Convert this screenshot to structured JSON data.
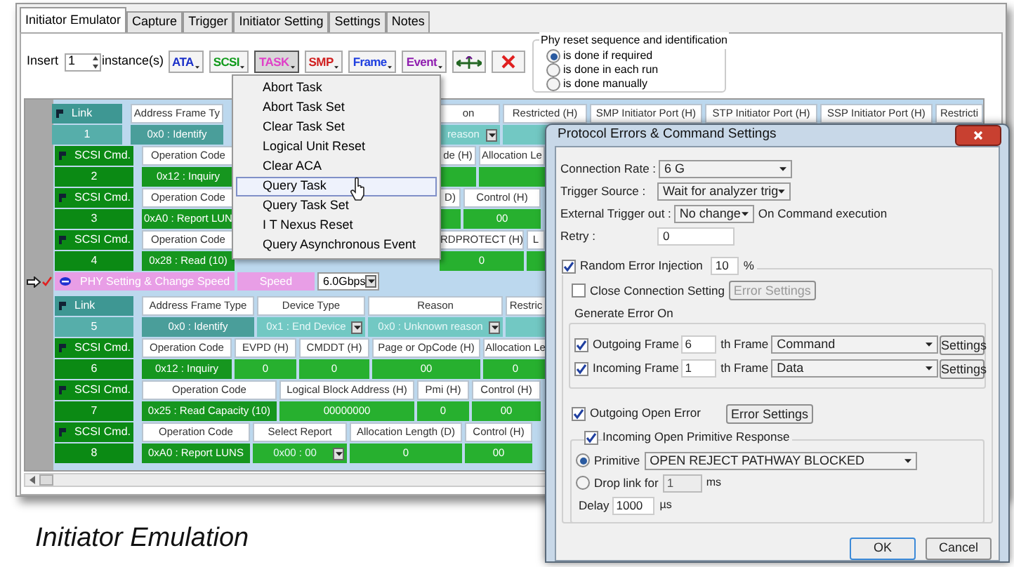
{
  "tabs": [
    {
      "label": "Initiator Emulator",
      "selected": true
    },
    {
      "label": "Capture",
      "selected": false
    },
    {
      "label": "Trigger",
      "selected": false
    },
    {
      "label": "Initiator Setting",
      "selected": false
    },
    {
      "label": "Settings",
      "selected": false
    },
    {
      "label": "Notes",
      "selected": false
    }
  ],
  "toolbar": {
    "insert_label": "Insert",
    "count": "1",
    "instances_label": "instance(s)",
    "buttons": [
      {
        "kind": "text",
        "label": "ATA",
        "color": "#1a2fc8",
        "pressed": false
      },
      {
        "kind": "text",
        "label": "SCSI",
        "color": "#0f9a1a",
        "pressed": false
      },
      {
        "kind": "text",
        "label": "TASK",
        "color": "#e040c8",
        "pressed": true
      },
      {
        "kind": "text",
        "label": "SMP",
        "color": "#d02020",
        "pressed": false
      },
      {
        "kind": "text",
        "label": "Frame",
        "color": "#2040e0",
        "pressed": false
      },
      {
        "kind": "text",
        "label": "Event",
        "color": "#9020b0",
        "pressed": false
      },
      {
        "kind": "arrows",
        "pressed": false
      },
      {
        "kind": "delete",
        "pressed": false
      }
    ]
  },
  "phy_reset": {
    "title": "Phy reset sequence and identification",
    "options": [
      {
        "label": "is done if required",
        "selected": true
      },
      {
        "label": "is done in each run",
        "selected": false
      },
      {
        "label": "is done manually",
        "selected": false
      }
    ]
  },
  "grid": {
    "rows": [
      {
        "kind": "link",
        "label": "Link",
        "number": "1",
        "cells": [
          {
            "kind": "key",
            "header": "Address Frame Ty",
            "value": "0x0 : Identify"
          },
          {
            "kind": "dropdown",
            "header": "on",
            "value": "reason"
          },
          {
            "kind": "plain",
            "header": "Restricted (H)"
          },
          {
            "kind": "plain",
            "header": "SMP Initiator Port (H)"
          },
          {
            "kind": "plain",
            "header": "STP Initiator Port (H)"
          },
          {
            "kind": "plain",
            "header": "SSP Initiator Port (H)"
          },
          {
            "kind": "plain",
            "header": "Restricti"
          }
        ]
      },
      {
        "kind": "scsi",
        "label": "SCSI Cmd.",
        "number": "2",
        "cells": [
          {
            "kind": "key",
            "header": "Operation Code",
            "value": "0x12 : Inquiry"
          },
          {
            "kind": "plain",
            "header": "de (H)"
          },
          {
            "kind": "plain",
            "header": "Allocation Le"
          }
        ]
      },
      {
        "kind": "scsi",
        "label": "SCSI Cmd.",
        "number": "3",
        "cells": [
          {
            "kind": "key",
            "header": "Operation Code",
            "value": "0xA0 : Report LUN"
          },
          {
            "kind": "plain",
            "header": "D)"
          },
          {
            "kind": "plain",
            "header": "Control (H)",
            "value": "00"
          }
        ]
      },
      {
        "kind": "scsi",
        "label": "SCSI Cmd.",
        "number": "4",
        "cells": [
          {
            "kind": "key",
            "header": "Operation Code",
            "value": "0x28 : Read (10)"
          },
          {
            "kind": "plain",
            "header": "RDPROTECT (H)",
            "value": "0"
          },
          {
            "kind": "plain",
            "header": "L"
          }
        ]
      },
      {
        "kind": "phy",
        "current": true,
        "checked": true,
        "label": "PHY Setting & Change Speed",
        "field": "Speed",
        "value": "6.0Gbps"
      },
      {
        "kind": "link",
        "label": "Link",
        "number": "5",
        "cells": [
          {
            "kind": "key",
            "header": "Address Frame Type",
            "value": "0x0 : Identify"
          },
          {
            "kind": "dropdown",
            "header": "Device Type",
            "value": "0x1 : End Device"
          },
          {
            "kind": "dropdown",
            "header": "Reason",
            "value": "0x0 : Unknown reason"
          },
          {
            "kind": "plain",
            "header": "Restric"
          }
        ]
      },
      {
        "kind": "scsi",
        "label": "SCSI Cmd.",
        "number": "6",
        "cells": [
          {
            "kind": "key",
            "header": "Operation Code",
            "value": "0x12 : Inquiry"
          },
          {
            "kind": "plain",
            "header": "EVPD (H)",
            "value": "0"
          },
          {
            "kind": "plain",
            "header": "CMDDT (H)",
            "value": "0"
          },
          {
            "kind": "plain",
            "header": "Page or OpCode (H)",
            "value": "00"
          },
          {
            "kind": "plain",
            "header": "Allocation Le",
            "value": "0"
          }
        ]
      },
      {
        "kind": "scsi",
        "label": "SCSI Cmd.",
        "number": "7",
        "cells": [
          {
            "kind": "key",
            "header": "Operation Code",
            "value": "0x25 : Read Capacity (10)"
          },
          {
            "kind": "plain",
            "header": "Logical Block Address (H)",
            "value": "00000000"
          },
          {
            "kind": "plain",
            "header": "Pmi (H)",
            "value": "0"
          },
          {
            "kind": "plain",
            "header": "Control (H)",
            "value": "00"
          }
        ]
      },
      {
        "kind": "scsi",
        "label": "SCSI Cmd.",
        "number": "8",
        "cells": [
          {
            "kind": "key",
            "header": "Operation Code",
            "value": "0xA0 : Report LUNS"
          },
          {
            "kind": "dropdown",
            "header": "Select Report",
            "value": "0x00 : 00"
          },
          {
            "kind": "plain",
            "header": "Allocation Length (D)",
            "value": "0"
          },
          {
            "kind": "plain",
            "header": "Control (H)",
            "value": "00"
          }
        ]
      }
    ]
  },
  "menu": {
    "items": [
      {
        "label": "Abort Task",
        "selected": false
      },
      {
        "label": "Abort Task Set",
        "selected": false
      },
      {
        "label": "Clear Task Set",
        "selected": false
      },
      {
        "label": "Logical Unit Reset",
        "selected": false
      },
      {
        "label": "Clear ACA",
        "selected": false
      },
      {
        "label": "Query Task",
        "selected": true
      },
      {
        "label": "Query Task Set",
        "selected": false
      },
      {
        "label": "I T Nexus Reset",
        "selected": false
      },
      {
        "label": "Query Asynchronous Event",
        "selected": false
      }
    ]
  },
  "dialog": {
    "title": "Protocol Errors & Command Settings",
    "fields": [
      {
        "kind": "select",
        "label": "Connection Rate :",
        "value": "6 G"
      },
      {
        "kind": "select",
        "label": "Trigger Source :",
        "value": "Wait for analyzer trig"
      },
      {
        "kind": "select_note",
        "label": "External Trigger out :",
        "value": "No change",
        "note": "On Command execution"
      },
      {
        "kind": "input",
        "label": "Retry :",
        "value": "0"
      }
    ],
    "random_error": {
      "label": "Random Error Injection",
      "checked": true,
      "value": "10",
      "unit": "%"
    },
    "close_connection": {
      "label": "Close Connection Setting",
      "checked": false,
      "button": "Error Settings",
      "button_disabled": true
    },
    "generate_error": {
      "title": "Generate Error On",
      "rows": [
        {
          "label": "Outgoing Frame",
          "checked": true,
          "value": "6",
          "suffix": "th Frame",
          "frame": "Command",
          "button": "Settings"
        },
        {
          "label": "Incoming Frame",
          "checked": true,
          "value": "1",
          "suffix": "th Frame",
          "frame": "Data",
          "button": "Settings"
        }
      ]
    },
    "open_error": {
      "label": "Outgoing Open Error",
      "checked": true,
      "button": "Error Settings",
      "button_disabled": false
    },
    "open_response": {
      "label": "Incoming Open Primitive Response",
      "checked": true,
      "options": [
        {
          "kind": "select",
          "label": "Primitive",
          "selected": true,
          "value": "OPEN REJECT PATHWAY BLOCKED"
        },
        {
          "kind": "input",
          "label": "Drop link for",
          "selected": false,
          "value": "1",
          "unit": "ms"
        }
      ],
      "delay": {
        "label": "Delay",
        "value": "1000",
        "unit": "µs"
      }
    },
    "buttons": [
      {
        "label": "OK",
        "default": true
      },
      {
        "label": "Cancel",
        "default": false
      }
    ]
  },
  "caption": "Initiator Emulation"
}
